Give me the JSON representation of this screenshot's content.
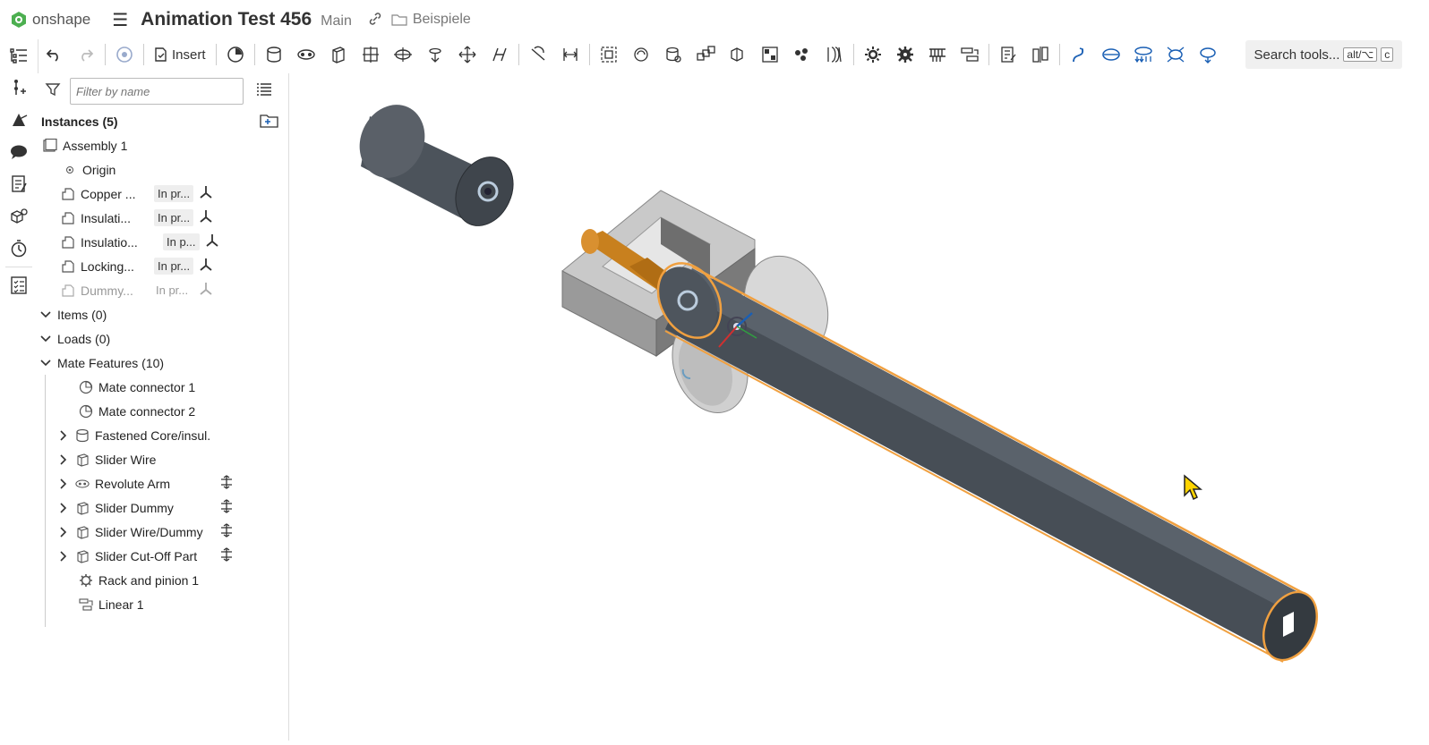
{
  "app": {
    "brand": "onshape"
  },
  "document": {
    "title": "Animation Test 456",
    "branch": "Main",
    "folder": "Beispiele"
  },
  "toolbar": {
    "insert_label": "Insert",
    "search_label": "Search tools...",
    "search_shortcut_1": "alt/⌥",
    "search_shortcut_2": "c"
  },
  "filter": {
    "placeholder": "Filter by name"
  },
  "tree": {
    "instances_header": "Instances (5)",
    "assembly": "Assembly 1",
    "origin": "Origin",
    "instances": [
      {
        "name": "Copper ...",
        "status": "In pr..."
      },
      {
        "name": "Insulati...",
        "status": "In pr..."
      },
      {
        "name": "Insulatio...",
        "status": "In p..."
      },
      {
        "name": "Locking...",
        "status": "In pr..."
      },
      {
        "name": "Dummy...",
        "status": "In pr..."
      }
    ],
    "items_header": "Items (0)",
    "loads_header": "Loads (0)",
    "mates_header": "Mate Features (10)",
    "mates": [
      {
        "label": "Mate connector 1"
      },
      {
        "label": "Mate connector 2"
      },
      {
        "label": "Fastened Core/insul."
      },
      {
        "label": "Slider Wire"
      },
      {
        "label": "Revolute Arm"
      },
      {
        "label": "Slider Dummy"
      },
      {
        "label": "Slider Wire/Dummy"
      },
      {
        "label": "Slider Cut-Off Part"
      },
      {
        "label": "Rack and pinion 1"
      },
      {
        "label": "Linear 1"
      }
    ]
  },
  "colors": {
    "accent": "#f0a040",
    "brand": "#4caf50",
    "part_gray": "#4a5058"
  }
}
